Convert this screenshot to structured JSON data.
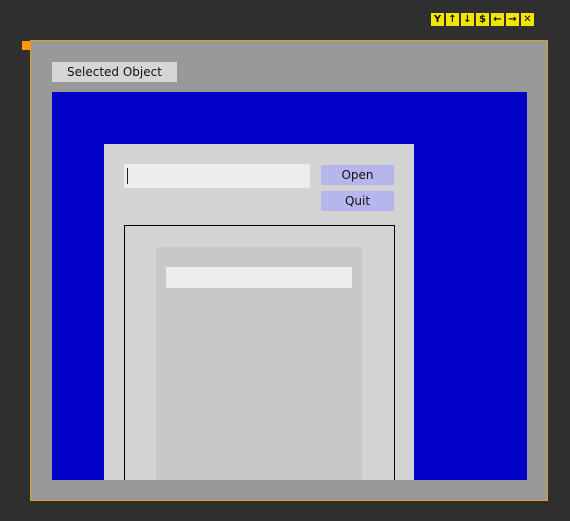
{
  "toolbar": {
    "buttons": [
      {
        "name": "fork-icon",
        "glyph": "Y"
      },
      {
        "name": "arrow-up-icon",
        "glyph": "↑"
      },
      {
        "name": "arrow-down-icon",
        "glyph": "↓"
      },
      {
        "name": "dollar-icon",
        "glyph": "$"
      },
      {
        "name": "arrow-left-icon",
        "glyph": "←"
      },
      {
        "name": "arrow-right-icon",
        "glyph": "→"
      },
      {
        "name": "close-icon",
        "glyph": "✕"
      }
    ]
  },
  "selected_label": "Selected Object",
  "dialog": {
    "input_value": "",
    "open_label": "Open",
    "quit_label": "Quit"
  },
  "colors": {
    "background": "#2f2f2f",
    "frame": "#989898",
    "frame_border": "#e0a020",
    "blue_area": "#0000c8",
    "button": "#b6b6ec",
    "toolbar_button": "#f2e600"
  }
}
